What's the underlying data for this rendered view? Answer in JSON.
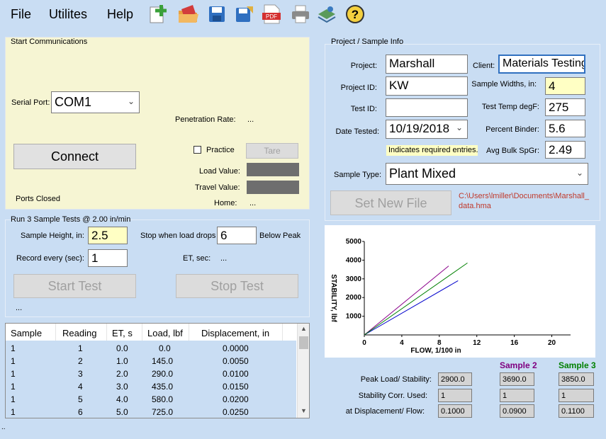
{
  "menu": {
    "file": "File",
    "utilities": "Utilites",
    "help": "Help"
  },
  "toolbar_icons": [
    "new-file-icon",
    "open-folder-icon",
    "save-icon",
    "save-as-icon",
    "pdf-icon",
    "print-icon",
    "export-icon",
    "help-icon"
  ],
  "start_comms": {
    "legend": "Start Communications",
    "serial_port_label": "Serial Port:",
    "serial_port_value": "COM1",
    "penetration_rate_label": "Penetration Rate:",
    "penetration_rate_value": "...",
    "connect_label": "Connect",
    "practice_label": "Practice",
    "tare_label": "Tare",
    "load_value_label": "Load Value:",
    "travel_value_label": "Travel Value:",
    "home_label": "Home:",
    "home_value": "...",
    "status": "Ports Closed"
  },
  "run": {
    "legend": "Run 3 Sample Tests @ 2.00 in/min",
    "sample_height_label": "Sample Height, in:",
    "sample_height_value": "2.5",
    "stop_when_label": "Stop when load drops",
    "stop_when_value": "6",
    "below_peak_label": "Below Peak",
    "record_every_label": "Record every (sec):",
    "record_every_value": "1",
    "et_label": "ET, sec:",
    "et_value": "...",
    "start_test_label": "Start Test",
    "stop_test_label": "Stop Test",
    "status": "..."
  },
  "table": {
    "headers": [
      "Sample",
      "Reading",
      "ET, s",
      "Load, lbf",
      "Displacement, in"
    ],
    "rows": [
      [
        "1",
        "1",
        "0.0",
        "0.0",
        "0.0000"
      ],
      [
        "1",
        "2",
        "1.0",
        "145.0",
        "0.0050"
      ],
      [
        "1",
        "3",
        "2.0",
        "290.0",
        "0.0100"
      ],
      [
        "1",
        "4",
        "3.0",
        "435.0",
        "0.0150"
      ],
      [
        "1",
        "5",
        "4.0",
        "580.0",
        "0.0200"
      ],
      [
        "1",
        "6",
        "5.0",
        "725.0",
        "0.0250"
      ]
    ]
  },
  "project": {
    "legend": "Project / Sample Info",
    "project_label": "Project:",
    "project_value": "Marshall",
    "client_label": "Client:",
    "client_value": "Materials Testing",
    "project_id_label": "Project ID:",
    "project_id_value": "KW",
    "sample_widths_label": "Sample Widths, in:",
    "sample_widths_value": "4",
    "test_id_label": "Test ID:",
    "test_id_value": "",
    "test_temp_label": "Test Temp degF:",
    "test_temp_value": "275",
    "date_tested_label": "Date Tested:",
    "date_tested_value": "10/19/2018",
    "percent_binder_label": "Percent Binder:",
    "percent_binder_value": "5.6",
    "required_note": "Indicates required entries.",
    "avg_bulk_label": "Avg Bulk SpGr:",
    "avg_bulk_value": "2.49",
    "sample_type_label": "Sample Type:",
    "sample_type_value": "Plant Mixed",
    "set_new_file_label": "Set New File",
    "file_path": "C:\\Users\\lmiller\\Documents\\Marshall_data.hma"
  },
  "chart_data": {
    "type": "line",
    "xlabel": "FLOW, 1/100 in",
    "ylabel": "STABILITY, lbf",
    "xlim": [
      0,
      22
    ],
    "ylim": [
      0,
      5000
    ],
    "xticks": [
      0,
      4,
      8,
      12,
      16,
      20
    ],
    "yticks": [
      1000,
      2000,
      3000,
      4000,
      5000
    ],
    "grid": false,
    "series": [
      {
        "color": "#0000cc",
        "x": [
          0,
          10
        ],
        "y": [
          0,
          2900
        ]
      },
      {
        "color": "#8b008b",
        "x": [
          0,
          9
        ],
        "y": [
          0,
          3690
        ]
      },
      {
        "color": "#008000",
        "x": [
          0,
          11
        ],
        "y": [
          0,
          3850
        ]
      }
    ]
  },
  "results": {
    "sample2_header": "Sample 2",
    "sample3_header": "Sample 3",
    "sample2_color": "#800080",
    "sample3_color": "#008000",
    "peak_label": "Peak Load/ Stability:",
    "corr_label": "Stability Corr. Used:",
    "disp_label": "at Displacement/ Flow:",
    "peak": [
      "2900.0",
      "3690.0",
      "3850.0"
    ],
    "corr": [
      "1",
      "1",
      "1"
    ],
    "disp": [
      "0.1000",
      "0.0900",
      "0.1100"
    ]
  },
  "footer": ".."
}
